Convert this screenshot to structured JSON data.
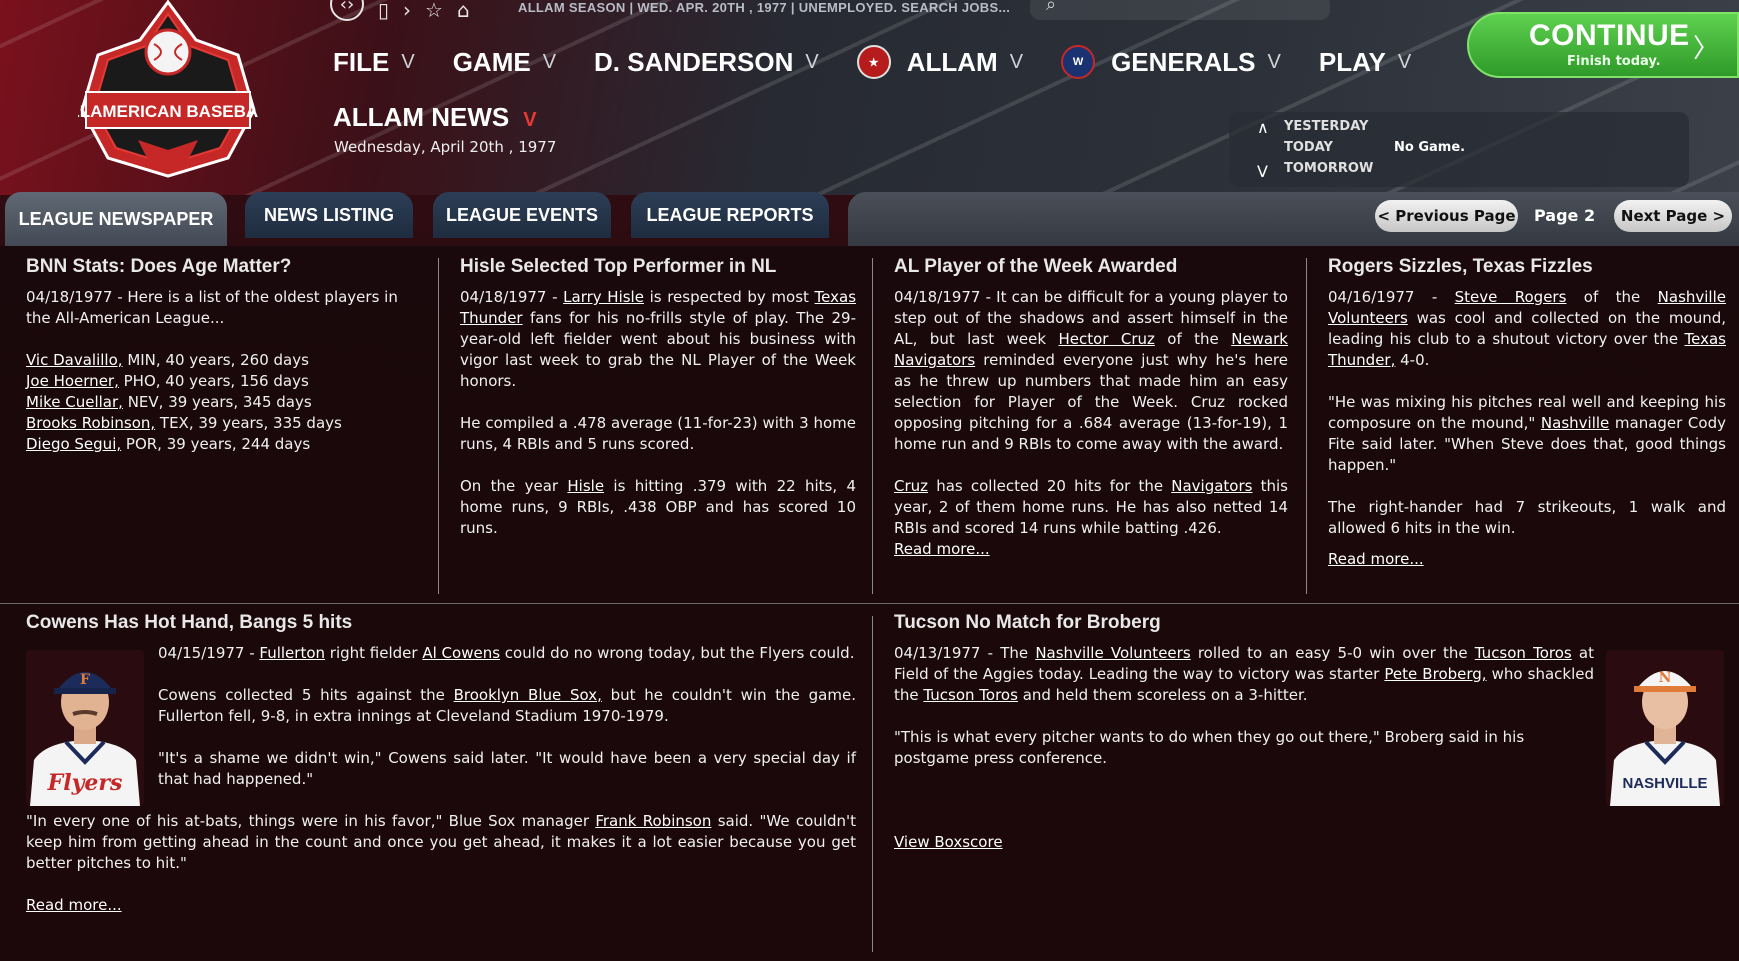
{
  "toolbar": {
    "status_text": "ALLAM SEASON  |  WED. APR. 20TH , 1977  |  UNEMPLOYED. SEARCH JOBS..."
  },
  "logo_text": "ALLAMERICAN BASEBALL",
  "menu": {
    "file": "FILE",
    "game": "GAME",
    "manager": "D. SANDERSON",
    "league": "ALLAM",
    "team": "GENERALS",
    "play": "PLAY",
    "chevron": "V"
  },
  "continue": {
    "label": "CONTINUE",
    "sub": "Finish today.",
    "arrow": "〉"
  },
  "page": {
    "title": "ALLAM NEWS",
    "title_chevron": "V",
    "date": "Wednesday, April 20th , 1977"
  },
  "day_nav": {
    "yesterday": "YESTERDAY",
    "today": "TODAY",
    "tomorrow": "TOMORROW",
    "today_status": "No Game.",
    "up": "∧",
    "down": "V"
  },
  "tabs": {
    "league_newspaper": "LEAGUE NEWSPAPER",
    "news_listing": "NEWS LISTING",
    "league_events": "LEAGUE EVENTS",
    "league_reports": "LEAGUE REPORTS"
  },
  "pager": {
    "prev": "< Previous Page",
    "label": "Page 2",
    "next": "Next Page >"
  },
  "articles": {
    "a1": {
      "title": "BNN Stats: Does Age Matter?",
      "intro": "04/18/1977 - Here is a list of the oldest players in the All-American League...",
      "players": [
        {
          "name": "Vic Davalillo,",
          "rest": " MIN, 40 years, 260 days"
        },
        {
          "name": "Joe Hoerner,",
          "rest": " PHO, 40 years, 156 days"
        },
        {
          "name": "Mike Cuellar,",
          "rest": " NEV, 39 years, 345 days"
        },
        {
          "name": "Brooks Robinson,",
          "rest": " TEX, 39 years, 335 days"
        },
        {
          "name": "Diego Segui,",
          "rest": " POR, 39 years, 244 days"
        }
      ]
    },
    "a2": {
      "title": "Hisle Selected Top Performer in NL",
      "p1_a": "04/18/1977 - ",
      "p1_link1": "Larry Hisle",
      "p1_b": " is respected by most ",
      "p1_link2": "Texas Thunder",
      "p1_c": " fans for his no-frills style of play. The 29-year-old left fielder went about his business with vigor last week to grab the NL Player of the Week honors.",
      "p2": "He compiled a .478 average (11-for-23) with 3 home runs, 4 RBIs and 5 runs scored.",
      "p3_a": "On the year ",
      "p3_link": "Hisle",
      "p3_b": " is hitting .379 with 22 hits, 4 home runs, 9 RBIs, .438 OBP and has scored 10 runs."
    },
    "a3": {
      "title": "AL Player of the Week Awarded",
      "p1_a": "04/18/1977 - It can be difficult for a young player to step out of the shadows and assert himself in the AL, but last week ",
      "p1_link1": "Hector Cruz",
      "p1_b": " of the ",
      "p1_link2": "Newark Navigators",
      "p1_c": " reminded everyone just why he's here as he threw up numbers that made him an easy selection for Player of the Week. Cruz rocked opposing pitching for a .684 average (13-for-19), 1 home run and 9 RBIs to come away with the award.",
      "p2_link1": "Cruz",
      "p2_a": " has collected 20 hits for the ",
      "p2_link2": "Navigators",
      "p2_b": " this year, 2 of them home runs. He has also netted 14 RBIs and scored 14 runs while batting .426.",
      "read_more": "Read more..."
    },
    "a4": {
      "title": "Rogers Sizzles, Texas Fizzles",
      "p1_a": "04/16/1977 - ",
      "p1_link1": "Steve Rogers",
      "p1_b": " of the ",
      "p1_link2": "Nashville Volunteers",
      "p1_c": " was cool and collected on the mound, leading his club to a shutout victory over the ",
      "p1_link3": "Texas Thunder,",
      "p1_d": " 4-0.",
      "p2_a": "\"He was mixing his pitches real well and keeping his composure on the mound,\" ",
      "p2_link": "Nashville",
      "p2_b": " manager Cody Fite said later. \"When Steve does that, good things happen.\"",
      "p3": "The right-hander had 7 strikeouts, 1 walk and allowed 6 hits in the win.",
      "read_more": "Read more..."
    },
    "a5": {
      "title": "Cowens Has Hot Hand, Bangs 5 hits",
      "p1_a": "04/15/1977 - ",
      "p1_link1": "Fullerton",
      "p1_b": " right fielder ",
      "p1_link2": "Al Cowens",
      "p1_c": " could do no wrong today, but the Flyers could.",
      "p2_a": "Cowens collected 5 hits against the ",
      "p2_link": "Brooklyn Blue Sox,",
      "p2_b": " but he couldn't win the game. Fullerton fell, 9-8, in extra innings at Cleveland Stadium 1970-1979.",
      "p3": "\"It's a shame we didn't win,\" Cowens said later. \"It would have been a very special day if that had happened.\"",
      "p4_a": "\"In every one of his at-bats, things were in his favor,\" Blue Sox manager ",
      "p4_link": "Frank Robinson",
      "p4_b": " said. \"We couldn't keep him from getting ahead in the count and once you get ahead, it makes it a lot easier because you get better pitches to hit.\"",
      "read_more": "Read more...",
      "jersey_text": "Flyers",
      "cap_letter": "F"
    },
    "a6": {
      "title": "Tucson No Match for Broberg",
      "p1_a": "04/13/1977 - The ",
      "p1_link1": "Nashville Volunteers",
      "p1_b": " rolled to an easy 5-0 win over the ",
      "p1_link2": "Tucson Toros",
      "p1_c": " at Field of the Aggies today. Leading the way to victory was starter ",
      "p1_link3": "Pete Broberg,",
      "p1_d": " who shackled the ",
      "p1_link4": "Tucson Toros",
      "p1_e": " and held them scoreless on a 3-hitter.",
      "p2": "\"This is what every pitcher wants to do when they go out there,\" Broberg said in his postgame press conference.",
      "boxscore": "View Boxscore",
      "jersey_text": "NASHVILLE",
      "cap_letter": "N"
    }
  },
  "colors": {
    "accent_red": "#e53935",
    "continue_green": "#3fb533",
    "tab_blue": "#26374d"
  }
}
